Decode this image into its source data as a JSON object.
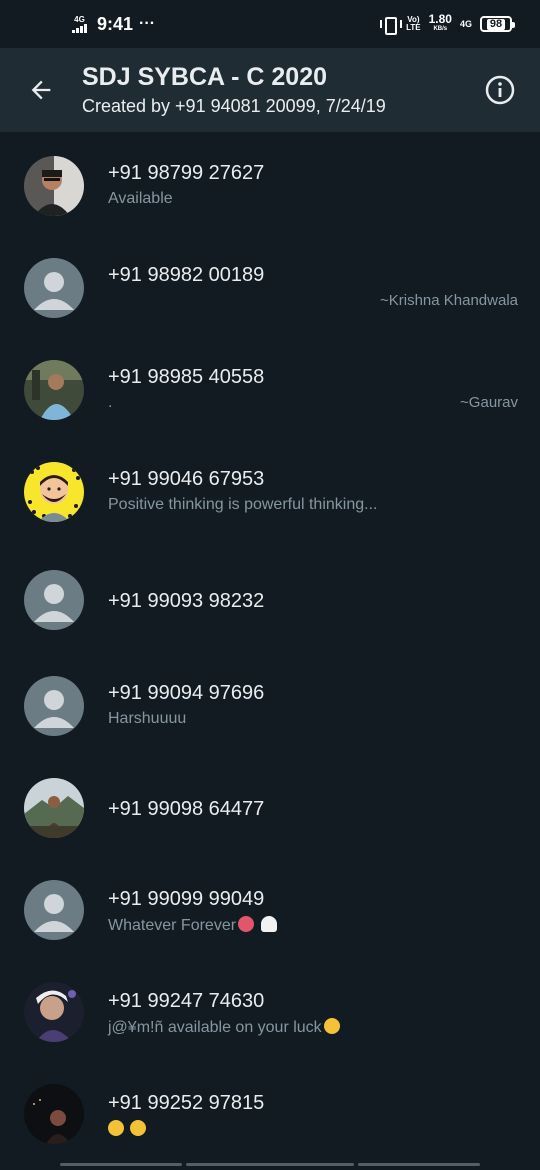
{
  "status_bar": {
    "network_label": "4G",
    "time": "9:41",
    "more": "···",
    "volte": "Vo)\nLTE",
    "speed_value": "1.80",
    "speed_unit": "KB/s",
    "network_right": "4G",
    "battery": "98"
  },
  "app_bar": {
    "title": "SDJ SYBCA - C 2020",
    "subtitle": "Created by +91 94081 20099, 7/24/19",
    "back_icon": "arrow-left-icon",
    "info_icon": "info-icon"
  },
  "participants": [
    {
      "phone": "+91 98799 27627",
      "about": "Available",
      "nickname": "",
      "avatar": "photo"
    },
    {
      "phone": "+91 98982 00189",
      "about": "",
      "nickname": "~Krishna Khandwala",
      "avatar": "default"
    },
    {
      "phone": "+91 98985 40558",
      "about": ".",
      "nickname": "~Gaurav",
      "avatar": "photo"
    },
    {
      "phone": "+91 99046 67953",
      "about": "Positive thinking is powerful thinking...",
      "nickname": "",
      "avatar": "bitmoji"
    },
    {
      "phone": "+91 99093 98232",
      "about": "",
      "nickname": "",
      "avatar": "default"
    },
    {
      "phone": "+91 99094 97696",
      "about": "Harshuuuu",
      "nickname": "",
      "avatar": "default"
    },
    {
      "phone": "+91 99098 64477",
      "about": "",
      "nickname": "",
      "avatar": "photo"
    },
    {
      "phone": "+91 99099 99049",
      "about": "Whatever Forever",
      "nickname": "",
      "avatar": "default"
    },
    {
      "phone": "+91 99247 74630",
      "about": "j@¥m!ñ  available on your luck",
      "nickname": "",
      "avatar": "photo"
    },
    {
      "phone": "+91 99252 97815",
      "about": "",
      "nickname": "",
      "avatar": "photo"
    }
  ],
  "colors": {
    "background": "#121b22",
    "app_bar": "#202c33",
    "primary_text": "#e9edef",
    "secondary_text": "#8696a0",
    "default_avatar_bg": "#6b7c85"
  }
}
